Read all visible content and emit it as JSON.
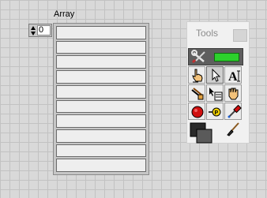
{
  "array": {
    "label": "Array",
    "index_value": "0",
    "element_count": 10
  },
  "tools_palette": {
    "title": "Tools",
    "tools": [
      {
        "name": "automatic-tool-selection",
        "icon": "wrench-screwdriver-icon"
      },
      {
        "name": "operate-value",
        "icon": "pointing-hand-icon"
      },
      {
        "name": "position-size-select",
        "icon": "arrow-cursor-icon"
      },
      {
        "name": "edit-text",
        "icon": "text-cursor-icon"
      },
      {
        "name": "connect-wire",
        "icon": "wiring-spool-icon"
      },
      {
        "name": "object-shortcut-menu",
        "icon": "menu-arrow-icon"
      },
      {
        "name": "scroll-window",
        "icon": "grab-hand-icon"
      },
      {
        "name": "set-clear-breakpoint",
        "icon": "stop-sign-icon"
      },
      {
        "name": "probe-data",
        "icon": "probe-icon"
      },
      {
        "name": "get-color",
        "icon": "eyedropper-icon"
      },
      {
        "name": "set-color",
        "icon": "color-box-icon"
      },
      {
        "name": "paint-brush",
        "icon": "paintbrush-icon"
      }
    ],
    "colors": {
      "auto_led": "#2cd12c",
      "breakpoint": "#d01010",
      "probe": "#f0d000"
    }
  }
}
